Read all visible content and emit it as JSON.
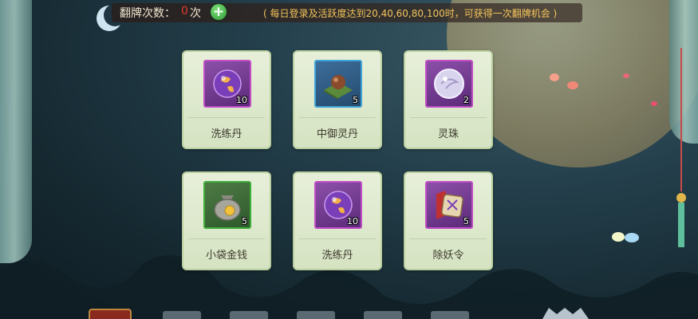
{
  "header": {
    "flip_label": "翻牌次数：",
    "flip_count": "0",
    "flip_unit": "次",
    "add_symbol": "+",
    "rule_text": "( 每日登录及活跃度达到20,40,60,80,100时，可获得一次翻牌机会 )"
  },
  "colors": {
    "count_red": "#e03c2e",
    "rule_gold": "#f4c45a",
    "rarity_purple": "#c24dc6",
    "rarity_green": "#3fae3c",
    "rarity_blue": "#3fa3d8"
  },
  "cards": [
    {
      "name": "洗练丹",
      "qty": "10",
      "icon": "purple-orb-icon",
      "rarity": "purple"
    },
    {
      "name": "中御灵丹",
      "qty": "5",
      "icon": "brown-pill-icon",
      "rarity": "blue"
    },
    {
      "name": "灵珠",
      "qty": "2",
      "icon": "spirit-pearl-icon",
      "rarity": "purple"
    },
    {
      "name": "小袋金钱",
      "qty": "5",
      "icon": "money-bag-icon",
      "rarity": "green"
    },
    {
      "name": "洗练丹",
      "qty": "10",
      "icon": "purple-orb-icon",
      "rarity": "purple"
    },
    {
      "name": "除妖令",
      "qty": "5",
      "icon": "demon-seal-icon",
      "rarity": "purple"
    }
  ]
}
